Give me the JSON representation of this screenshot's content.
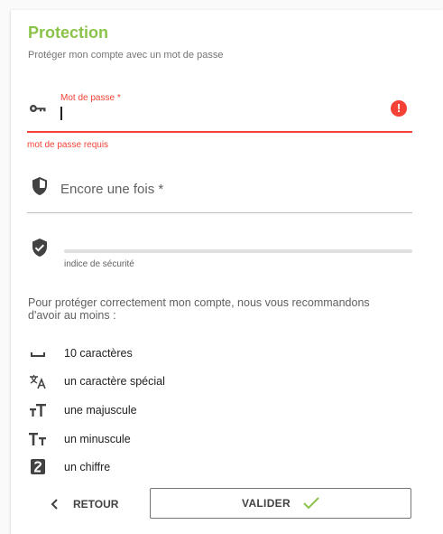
{
  "section": {
    "title": "Protection",
    "subtitle": "Protéger mon compte avec un mot de passe"
  },
  "password_field": {
    "label": "Mot de passe *",
    "value": "",
    "error": "mot de passe requis",
    "error_icon": "!",
    "icon": "key-icon"
  },
  "confirm_field": {
    "placeholder": "Encore une fois *",
    "value": "",
    "icon": "shield-icon"
  },
  "strength": {
    "label": "indice de sécurité",
    "level": 0,
    "icon": "shield-check-icon"
  },
  "recommendation": "Pour protéger correctement mon compte, nous vous recommandons d'avoir au moins :",
  "requirements": [
    {
      "icon": "space-bar-icon",
      "text": "10 caractères"
    },
    {
      "icon": "translate-icon",
      "text": "un caractère spécial"
    },
    {
      "icon": "format-size-icon",
      "text": "une majuscule"
    },
    {
      "icon": "text-case-icon",
      "text": "un minuscule"
    },
    {
      "icon": "numeric-2-box-icon",
      "text": "un chiffre"
    }
  ],
  "actions": {
    "back_label": "RETOUR",
    "submit_label": "VALIDER"
  },
  "colors": {
    "accent": "#8bc34a",
    "error": "#f44336",
    "text": "#212121",
    "muted": "#616161"
  }
}
